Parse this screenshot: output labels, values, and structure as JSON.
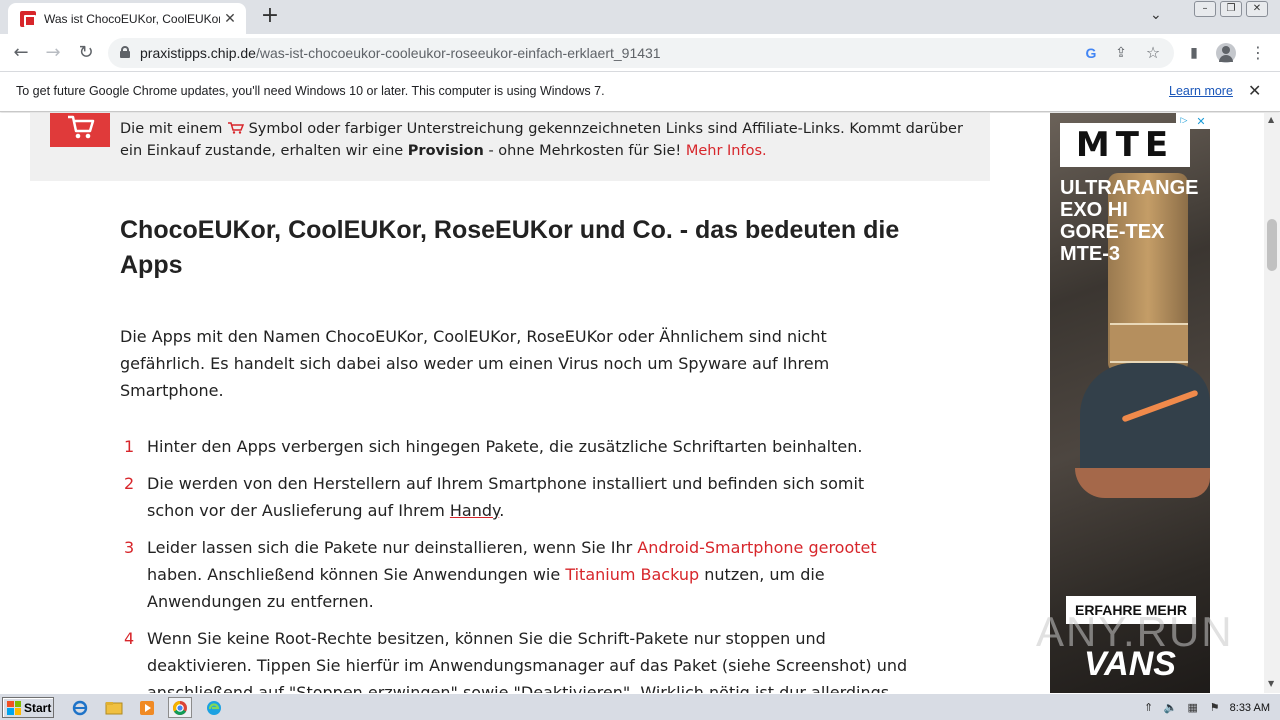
{
  "browser": {
    "tab_title": "Was ist ChocoEUKor, CoolEUKor, Ro",
    "tab_close": "✕",
    "new_tab": "+",
    "url_host": "praxistipps.chip.de",
    "url_path": "/was-ist-chocoeukor-cooleukor-roseeukor-einfach-erklaert_91431"
  },
  "infobar": {
    "message": "To get future Google Chrome updates, you'll need Windows 10 or later. This computer is using Windows 7.",
    "learn_more": "Learn more",
    "close": "✕"
  },
  "affiliate": {
    "text_part1": "Die mit einem",
    "text_part2": "Symbol oder farbiger Unterstreichung gekennzeichneten Links sind Affiliate-Links. Kommt darüber ein Einkauf zustande, erhalten wir eine",
    "bold": "Provision",
    "text_part3": "- ohne Mehrkosten für Sie!",
    "link": "Mehr Infos."
  },
  "article": {
    "heading": "ChocoEUKor, CoolEUKor, RoseEUKor und Co. - das bedeuten die Apps",
    "intro": "Die Apps mit den Namen ChocoEUKor, CoolEUKor, RoseEUKor oder Ähnlichem sind nicht gefährlich. Es handelt sich dabei also weder um einen Virus noch um Spyware auf Ihrem Smartphone.",
    "items": [
      {
        "num": "1",
        "text": "Hinter den Apps verbergen sich hingegen Pakete, die zusätzliche Schriftarten beinhalten."
      },
      {
        "num": "2",
        "text_a": "Die werden von den Herstellern auf Ihrem Smartphone installiert und befinden sich somit schon vor der Auslieferung auf Ihrem",
        "link": "Handy",
        "text_b": "."
      },
      {
        "num": "3",
        "text_a": "Leider lassen sich die Pakete nur deinstallieren, wenn Sie Ihr",
        "link1": "Android-Smartphone gerootet",
        "text_b": "haben. Anschließend können Sie Anwendungen wie",
        "link2": "Titanium Backup",
        "text_c": "nutzen, um die Anwendungen zu entfernen."
      },
      {
        "num": "4",
        "text": "Wenn Sie keine Root-Rechte besitzen, können Sie die Schrift-Pakete nur stoppen und deaktivieren. Tippen Sie hierfür im Anwendungsmanager auf das Paket (siehe Screenshot) und anschließend auf \"Stoppen erzwingen\" sowie \"Deaktivieren\". Wirklich nötig ist dur allerdings"
      }
    ]
  },
  "ad": {
    "brand_box": "MTE",
    "lines": [
      "ULTRARANGE",
      "EXO HI",
      "GORE-TEX",
      "MTE-3"
    ],
    "cta": "ERFAHRE MEHR",
    "brand": "VANS"
  },
  "watermark": "ANY.RUN",
  "taskbar": {
    "start": "Start",
    "time": "8:33 AM"
  },
  "colors": {
    "accent_red": "#d7262b",
    "link_blue": "#1a56b9"
  }
}
